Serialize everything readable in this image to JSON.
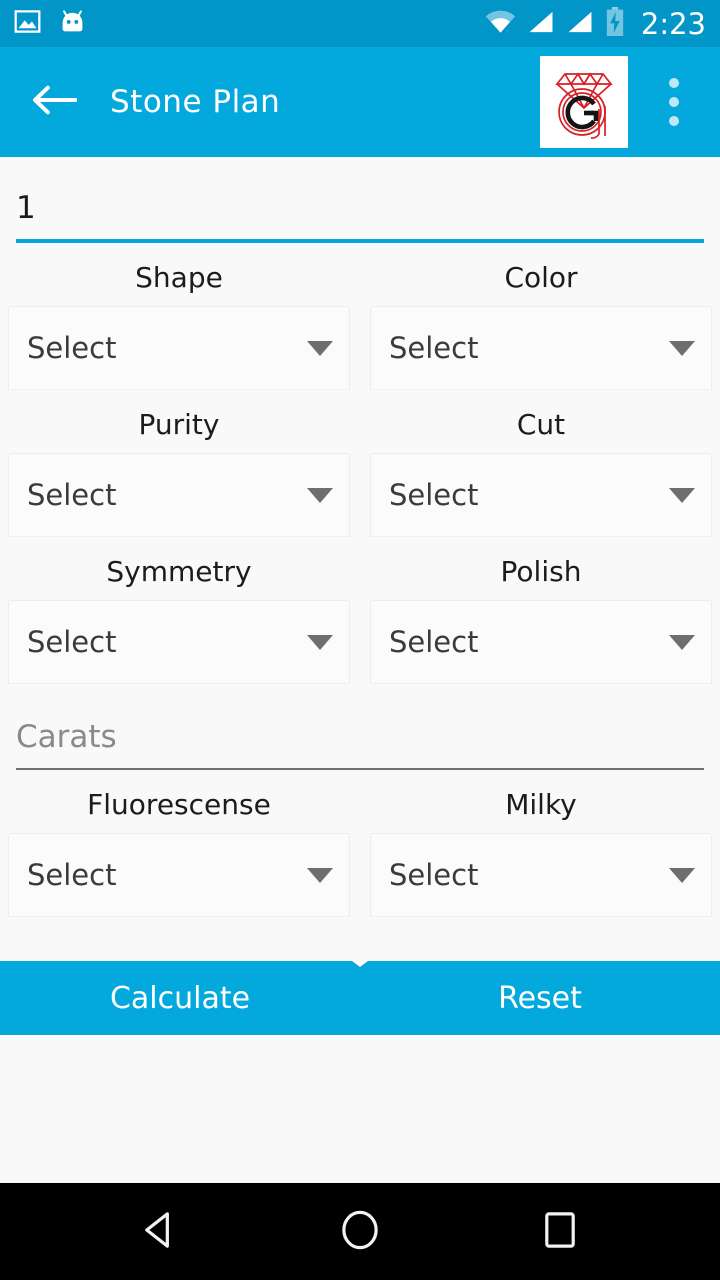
{
  "status_bar": {
    "time": "2:23",
    "icons": [
      "image-icon",
      "android-head-icon",
      "wifi-icon",
      "signal-icon",
      "signal-icon",
      "battery-charging-icon"
    ],
    "background": "#0295c8"
  },
  "app_bar": {
    "title": "Stone Plan",
    "back_icon": "back-arrow-icon",
    "logo_alt": "diamond-ring-g-logo",
    "overflow_icon": "overflow-menu-icon",
    "background": "#03a9dc"
  },
  "form": {
    "quantity": {
      "value": "1",
      "placeholder": ""
    },
    "carats": {
      "value": "",
      "placeholder": "Carats"
    },
    "rows": [
      {
        "left": {
          "label": "Shape",
          "value": "Select"
        },
        "right": {
          "label": "Color",
          "value": "Select"
        }
      },
      {
        "left": {
          "label": "Purity",
          "value": "Select"
        },
        "right": {
          "label": "Cut",
          "value": "Select"
        }
      },
      {
        "left": {
          "label": "Symmetry",
          "value": "Select"
        },
        "right": {
          "label": "Polish",
          "value": "Select"
        }
      }
    ],
    "rows_after_carats": [
      {
        "left": {
          "label": "Fluorescense",
          "value": "Select"
        },
        "right": {
          "label": "Milky",
          "value": "Select"
        }
      }
    ]
  },
  "actions": {
    "calculate_label": "Calculate",
    "reset_label": "Reset",
    "accent": "#03a9dc"
  },
  "nav_bar": {
    "back": "nav-back-icon",
    "home": "nav-home-icon",
    "recents": "nav-recents-icon"
  },
  "colors": {
    "accent": "#03a9dc",
    "status_bar": "#0295c8",
    "page_bg": "#f9f9f9",
    "logo_red": "#d81f26"
  }
}
